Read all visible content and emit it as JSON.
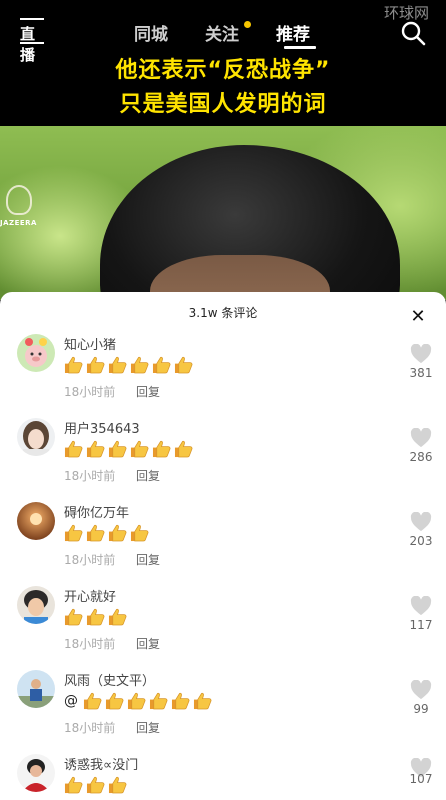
{
  "watermark": "环球网",
  "tabs": [
    {
      "label": "同城"
    },
    {
      "label": "关注"
    },
    {
      "label": "推荐"
    }
  ],
  "live_label": "直播",
  "caption": {
    "line1": "他还表示“反恐战争”",
    "line2": "只是美国人发明的词"
  },
  "video_logo_text": "JAZEERA",
  "comments_panel": {
    "title": "3.1w 条评论",
    "close_label": "✕",
    "comments": [
      {
        "username": "知心小猪",
        "prefix": "",
        "thumbs": 6,
        "time": "18小时前",
        "reply": "回复",
        "likes": "381"
      },
      {
        "username": "用户354643",
        "prefix": "",
        "thumbs": 6,
        "time": "18小时前",
        "reply": "回复",
        "likes": "286"
      },
      {
        "username": "碍你亿万年",
        "prefix": "",
        "thumbs": 4,
        "time": "18小时前",
        "reply": "回复",
        "likes": "203"
      },
      {
        "username": "开心就好",
        "prefix": "",
        "thumbs": 3,
        "time": "18小时前",
        "reply": "回复",
        "likes": "117"
      },
      {
        "username": "风雨（史文平）",
        "prefix": "@",
        "thumbs": 6,
        "time": "18小时前",
        "reply": "回复",
        "likes": "99"
      },
      {
        "username": "诱惑我∝没门",
        "prefix": "",
        "thumbs": 3,
        "time": "",
        "reply": "",
        "likes": "107"
      }
    ]
  },
  "colors": {
    "caption": "#ffe400",
    "notify_dot": "#f7c600",
    "like_icon": "#d3d3d3"
  },
  "icons": [
    "live-icon",
    "search-icon",
    "close-icon",
    "thumbs-up-emoji",
    "heart-icon"
  ]
}
